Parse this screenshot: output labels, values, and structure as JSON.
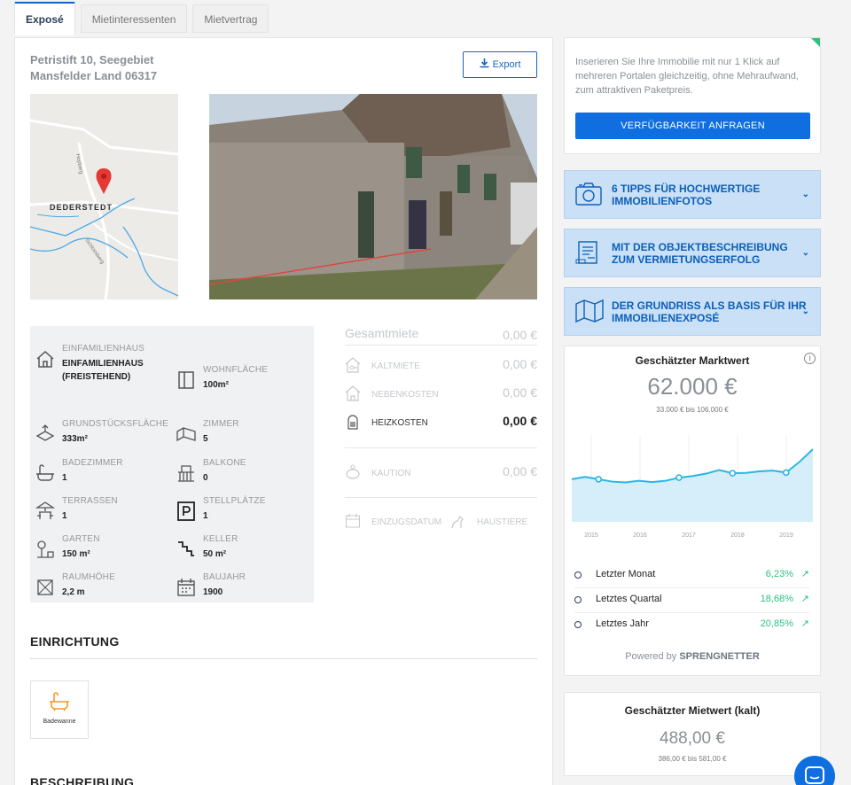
{
  "tabs": [
    "Exposé",
    "Mietinteressenten",
    "Mietvertrag"
  ],
  "address": {
    "line1": "Petristift 10, Seegebiet",
    "line2": "Mansfelder Land 06317"
  },
  "export_label": "Export",
  "map": {
    "place_label": "DEDERSTEDT",
    "street1": "Hopberg",
    "street2": "Schlossberg"
  },
  "features": [
    {
      "label": "EINFAMILIENHAUS",
      "value": "EINFAMILIENHAUS\n(FREISTEHEND)",
      "icon": "house-icon"
    },
    {
      "label": "WOHNFLÄCHE",
      "value": "100m²",
      "icon": "floor-area-icon"
    },
    {
      "label": "GRUNDSTÜCKSFLÄCHE",
      "value": "333m²",
      "icon": "plot-area-icon"
    },
    {
      "label": "ZIMMER",
      "value": "5",
      "icon": "rooms-icon"
    },
    {
      "label": "BADEZIMMER",
      "value": "1",
      "icon": "bathtub-icon"
    },
    {
      "label": "BALKONE",
      "value": "0",
      "icon": "balcony-icon"
    },
    {
      "label": "TERRASSEN",
      "value": "1",
      "icon": "terrace-icon"
    },
    {
      "label": "STELLPLÄTZE",
      "value": "1",
      "icon": "parking-icon"
    },
    {
      "label": "GARTEN",
      "value": "150 m²",
      "icon": "garden-icon"
    },
    {
      "label": "KELLER",
      "value": "50 m²",
      "icon": "cellar-icon"
    },
    {
      "label": "RAUMHÖHE",
      "value": "2,2 m",
      "icon": "room-height-icon"
    },
    {
      "label": "BAUJAHR",
      "value": "1900",
      "icon": "calendar-icon"
    }
  ],
  "rent": {
    "total_label": "Gesamtmiete",
    "total_value": "0,00 €",
    "kalt_label": "KALTMIETE",
    "kalt_value": "0,00 €",
    "neben_label": "NEBENKOSTEN",
    "neben_value": "0,00 €",
    "heiz_label": "HEIZKOSTEN",
    "heiz_value": "0,00 €",
    "kaution_label": "KAUTION",
    "kaution_value": "0,00 €",
    "einzug_label": "EINZUGSDATUM",
    "haustiere_label": "HAUSTIERE"
  },
  "einrichtung": {
    "title": "EINRICHTUNG",
    "item_label": "Badewanne"
  },
  "beschreibung_title": "BESCHREIBUNG",
  "promo": {
    "text": "Inserieren Sie Ihre Immobilie mit nur 1 Klick auf mehreren Portalen gleichzeitig, ohne Mehraufwand, zum attraktiven Paketpreis.",
    "button": "VERFÜGBARKEIT ANFRAGEN"
  },
  "accordions": [
    {
      "label": "6 TIPPS FÜR HOCHWERTIGE IMMOBILIENFOTOS",
      "icon": "camera-icon"
    },
    {
      "label": "MIT DER OBJEKTBESCHREIBUNG ZUM VERMIETUNGSERFOLG",
      "icon": "document-icon"
    },
    {
      "label": "DER GRUNDRISS ALS BASIS FÜR IHR IMMOBILIENEXPOSÉ",
      "icon": "floorplan-icon"
    }
  ],
  "market": {
    "title": "Geschätzter Marktwert",
    "value": "62.000 €",
    "range": "33.000 € bis 106.000 €",
    "periods": [
      {
        "label": "Letzter Monat",
        "value": "6,23%"
      },
      {
        "label": "Letztes Quartal",
        "value": "18,68%"
      },
      {
        "label": "Letztes Jahr",
        "value": "20,85%"
      }
    ],
    "powered_prefix": "Powered by",
    "powered_brand": "SPRENGNETTER"
  },
  "chart_data": {
    "type": "area",
    "x_ticks": [
      "2015",
      "2016",
      "2017",
      "2018",
      "2019"
    ],
    "x": [
      0,
      1,
      2,
      3,
      4,
      5,
      6,
      7,
      8,
      9,
      10,
      11,
      12,
      13,
      14,
      15,
      16,
      17,
      18
    ],
    "values": [
      47.0,
      48.5,
      47.0,
      45.5,
      45.0,
      46.0,
      45.2,
      46.0,
      48.0,
      49.0,
      50.5,
      52.8,
      50.8,
      51.0,
      52.0,
      52.5,
      51.2,
      58.0,
      66.0
    ],
    "markers": [
      2,
      8,
      12,
      16
    ]
  },
  "rent_estimate": {
    "title": "Geschätzter Mietwert (kalt)",
    "value": "488,00 €",
    "range": "386,00 € bis 581,00 €"
  }
}
